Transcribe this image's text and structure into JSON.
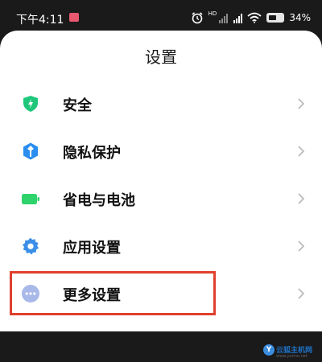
{
  "status_bar": {
    "time": "下午4:11",
    "network_badge": "HD",
    "battery_percent": "34%"
  },
  "screen": {
    "title": "设置"
  },
  "menu": [
    {
      "label": "安全",
      "icon": "shield-icon",
      "color": "#1fc77a"
    },
    {
      "label": "隐私保护",
      "icon": "privacy-icon",
      "color": "#2a8df0"
    },
    {
      "label": "省电与电池",
      "icon": "battery-icon",
      "color": "#2fd36b"
    },
    {
      "label": "应用设置",
      "icon": "gear-icon",
      "color": "#3b8fe8"
    },
    {
      "label": "更多设置",
      "icon": "more-icon",
      "color": "#a8b8e8"
    }
  ],
  "highlight_color": "#e0402e",
  "watermark": {
    "logo_letter": "Y",
    "name": "云狐主机网",
    "url": "www.yunnu.net"
  }
}
